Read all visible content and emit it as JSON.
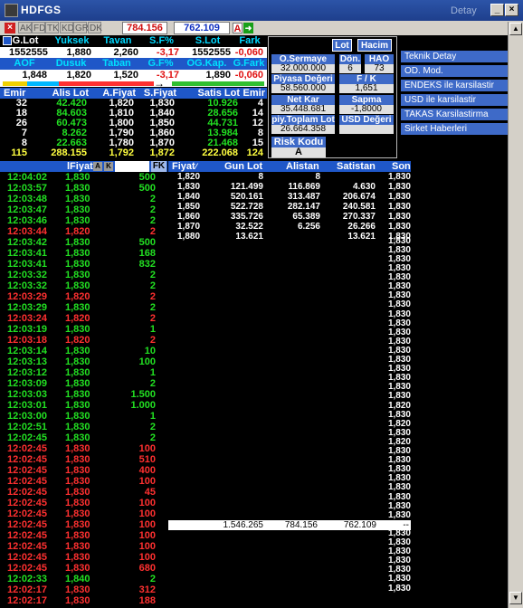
{
  "window": {
    "title": "HDFGS",
    "detay": "Detay"
  },
  "toolbar": {
    "tabs": [
      "AK",
      "FD",
      "TK",
      "KD",
      "GR",
      "DK"
    ],
    "value1": "784.156",
    "value2": "762.109",
    "a_label": "A"
  },
  "summary": {
    "headers1": [
      "G.Lot",
      "Yuksek",
      "Tavan",
      "S.F%",
      "S.Lot",
      "Fark"
    ],
    "values1": [
      "1552555",
      "1,880",
      "2,260",
      "-3,17",
      "1552555",
      "-0,060"
    ],
    "headers2": [
      "AOF",
      "Dusuk",
      "Taban",
      "G.F%",
      "OG.Kap.",
      "G.Fark"
    ],
    "values2": [
      "1,848",
      "1,820",
      "1,520",
      "-3,17",
      "1,890",
      "-0,060"
    ]
  },
  "depth": {
    "headers": [
      "Emir",
      "Alis Lot",
      "A.Fiyat",
      "S.Fiyat",
      "Satis Lot",
      "Emir"
    ],
    "rows": [
      [
        "32",
        "42.420",
        "1,820",
        "1,830",
        "10.926",
        "4"
      ],
      [
        "18",
        "84.603",
        "1,810",
        "1,840",
        "28.656",
        "14"
      ],
      [
        "26",
        "60.473",
        "1,800",
        "1,850",
        "44.731",
        "12"
      ],
      [
        "7",
        "8.262",
        "1,790",
        "1,860",
        "13.984",
        "8"
      ],
      [
        "8",
        "22.663",
        "1,780",
        "1,870",
        "21.468",
        "15"
      ]
    ],
    "total": [
      "115",
      "288.155",
      "1,792",
      "1,872",
      "222.068",
      "124"
    ]
  },
  "panel": {
    "lot_btn": "Lot",
    "hacim_btn": "Hacim",
    "o_sermaye_label": "O.Sermaye",
    "o_sermaye_value": "32.000.000",
    "don_label": "Dön.",
    "don_value": "6",
    "hao_label": "HAO",
    "hao_value": "73",
    "piyasa_label": "Piyasa Değeri",
    "piyasa_value": "58.560.000",
    "fk_label": "F / K",
    "fk_value": "1,651",
    "netkar_label": "Net Kar",
    "netkar_value": "35.448.681",
    "sapma_label": "Sapma",
    "sapma_value": "-1,8000",
    "piy_toplam_label": "piy.Toplam Lot",
    "piy_toplam_value": "26.664.358",
    "usd_label": "USD Değeri",
    "usd_value": "",
    "risk_label": "Risk Kodu",
    "risk_value": "A"
  },
  "menu": [
    "Teknik Detay",
    "OD. Mod.",
    "ENDEKS ile karsilastir",
    "USD ile karsilastir",
    "TAKAS Karsilastirma",
    "Sirket Haberleri"
  ],
  "trades": {
    "header_fiyat": "lFiyat",
    "header_a": "A",
    "header_k": "K",
    "header_fk": "FK",
    "rows": [
      [
        "12:04:02",
        "1,830",
        "500",
        "g"
      ],
      [
        "12:03:57",
        "1,830",
        "500",
        "g"
      ],
      [
        "12:03:48",
        "1,830",
        "2",
        "g"
      ],
      [
        "12:03:47",
        "1,830",
        "2",
        "g"
      ],
      [
        "12:03:46",
        "1,830",
        "2",
        "g"
      ],
      [
        "12:03:44",
        "1,820",
        "2",
        "r"
      ],
      [
        "12:03:42",
        "1,830",
        "500",
        "g"
      ],
      [
        "12:03:41",
        "1,830",
        "168",
        "g"
      ],
      [
        "12:03:41",
        "1,830",
        "832",
        "g"
      ],
      [
        "12:03:32",
        "1,830",
        "2",
        "g"
      ],
      [
        "12:03:32",
        "1,830",
        "2",
        "g"
      ],
      [
        "12:03:29",
        "1,820",
        "2",
        "r"
      ],
      [
        "12:03:29",
        "1,830",
        "2",
        "g"
      ],
      [
        "12:03:24",
        "1,820",
        "2",
        "r"
      ],
      [
        "12:03:19",
        "1,830",
        "1",
        "g"
      ],
      [
        "12:03:18",
        "1,820",
        "2",
        "r"
      ],
      [
        "12:03:14",
        "1,830",
        "10",
        "g"
      ],
      [
        "12:03:13",
        "1,830",
        "100",
        "g"
      ],
      [
        "12:03:12",
        "1,830",
        "1",
        "g"
      ],
      [
        "12:03:09",
        "1,830",
        "2",
        "g"
      ],
      [
        "12:03:03",
        "1,830",
        "1.500",
        "g"
      ],
      [
        "12:03:01",
        "1,830",
        "1.000",
        "g"
      ],
      [
        "12:03:00",
        "1,830",
        "1",
        "g"
      ],
      [
        "12:02:51",
        "1,830",
        "2",
        "g"
      ],
      [
        "12:02:45",
        "1,830",
        "2",
        "g"
      ],
      [
        "12:02:45",
        "1,830",
        "100",
        "r"
      ],
      [
        "12:02:45",
        "1,830",
        "510",
        "r"
      ],
      [
        "12:02:45",
        "1,830",
        "400",
        "r"
      ],
      [
        "12:02:45",
        "1,830",
        "100",
        "r"
      ],
      [
        "12:02:45",
        "1,830",
        "45",
        "r"
      ],
      [
        "12:02:45",
        "1,830",
        "100",
        "r"
      ],
      [
        "12:02:45",
        "1,830",
        "100",
        "r"
      ],
      [
        "12:02:45",
        "1,830",
        "100",
        "r"
      ],
      [
        "12:02:45",
        "1,830",
        "100",
        "r"
      ],
      [
        "12:02:45",
        "1,830",
        "100",
        "r"
      ],
      [
        "12:02:45",
        "1,830",
        "100",
        "r"
      ],
      [
        "12:02:45",
        "1,830",
        "680",
        "r"
      ],
      [
        "12:02:33",
        "1,840",
        "2",
        "g"
      ],
      [
        "12:02:17",
        "1,830",
        "312",
        "r"
      ],
      [
        "12:02:17",
        "1,830",
        "188",
        "r"
      ]
    ]
  },
  "distribution": {
    "headers": [
      "Fiyat",
      "Gun Lot",
      "Alistan",
      "Satistan",
      "Son"
    ],
    "rows": [
      [
        "1,820",
        "8",
        "8",
        "",
        "1,830"
      ],
      [
        "1,830",
        "121.499",
        "116.869",
        "4.630",
        "1,830"
      ],
      [
        "1,840",
        "520.161",
        "313.487",
        "206.674",
        "1,830"
      ],
      [
        "1,850",
        "522.728",
        "282.147",
        "240.581",
        "1,830"
      ],
      [
        "1,860",
        "335.726",
        "65.389",
        "270.337",
        "1,830"
      ],
      [
        "1,870",
        "32.522",
        "6.256",
        "26.266",
        "1,830"
      ],
      [
        "1,880",
        "13.621",
        "",
        "13.621",
        "1,830"
      ]
    ],
    "son_column": [
      "1,830",
      "1,830",
      "1,830",
      "1,830",
      "1,830",
      "1,830",
      "1,830",
      "1,830",
      "1,830",
      "1,830",
      "1,830",
      "1,830",
      "1,830",
      "1,830",
      "1,830",
      "1,830",
      "1,830",
      "1,830",
      "1,820",
      "1,830",
      "1,820",
      "1,830",
      "1,820",
      "1,830",
      "1,830",
      "1,830",
      "1,830",
      "1,830",
      "1,830",
      "1,830",
      "1,830",
      "1,830",
      "1,830",
      "1,830",
      "1,830",
      "1,830",
      "1,830",
      "1,830",
      "1,830"
    ],
    "totals": [
      "1.546.265",
      "784.156",
      "762.109",
      "--"
    ]
  }
}
